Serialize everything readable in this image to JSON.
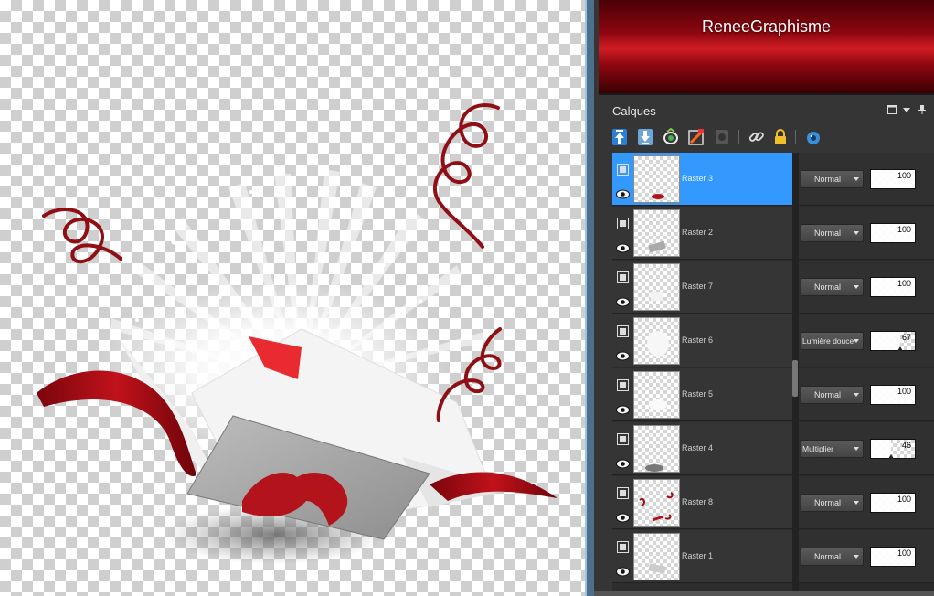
{
  "banner": {
    "title": "ReneeGraphisme"
  },
  "layers_panel": {
    "title": "Calques",
    "header_controls": [
      "restore-icon",
      "menu-arrow-icon",
      "pin-icon"
    ],
    "toolbar": [
      "new-layer-above-icon",
      "new-layer-below-icon",
      "layer-effects-icon",
      "layer-style-icon",
      "mask-icon",
      "link-icon",
      "lock-icon",
      "visibility-icon"
    ],
    "layers": [
      {
        "name": "Raster 3",
        "blend": "Normal",
        "opacity": 100,
        "selected": true
      },
      {
        "name": "Raster 2",
        "blend": "Normal",
        "opacity": 100,
        "selected": false
      },
      {
        "name": "Raster 7",
        "blend": "Normal",
        "opacity": 100,
        "selected": false
      },
      {
        "name": "Raster 6",
        "blend": "Lumière douce",
        "opacity": 67,
        "selected": false
      },
      {
        "name": "Raster 5",
        "blend": "Normal",
        "opacity": 100,
        "selected": false
      },
      {
        "name": "Raster 4",
        "blend": "Multiplier",
        "opacity": 46,
        "selected": false
      },
      {
        "name": "Raster 8",
        "blend": "Normal",
        "opacity": 100,
        "selected": false
      },
      {
        "name": "Raster 1",
        "blend": "Normal",
        "opacity": 100,
        "selected": false
      }
    ]
  },
  "colors": {
    "accent": "#3399ff",
    "banner_red": "#c3141b",
    "ribbon_red": "#9b0b12"
  }
}
